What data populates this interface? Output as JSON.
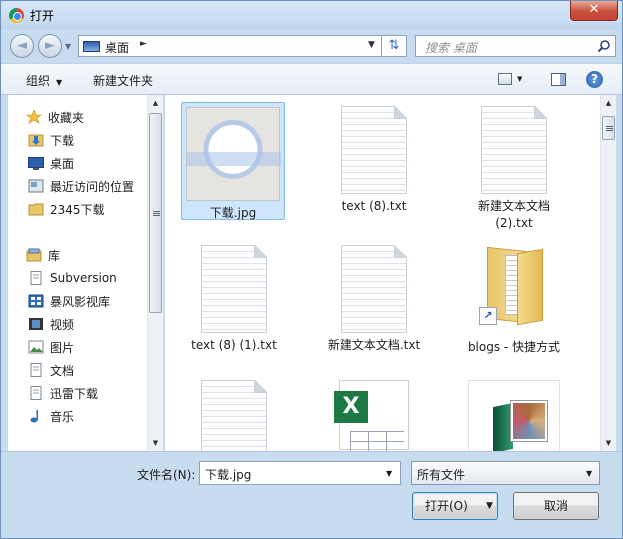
{
  "window": {
    "title": "打开",
    "close_glyph": "✕"
  },
  "nav": {
    "back_glyph": "◄",
    "forward_glyph": "►",
    "address": {
      "location": "桌面",
      "separator": "►"
    },
    "search_placeholder": "搜索 桌面"
  },
  "toolbar": {
    "organize_label": "组织",
    "new_folder_label": "新建文件夹",
    "help_glyph": "?"
  },
  "sidebar": {
    "items": [
      {
        "label": "收藏夹",
        "icon": "star-icon"
      },
      {
        "label": "下载",
        "icon": "download-folder-icon"
      },
      {
        "label": "桌面",
        "icon": "desktop-icon"
      },
      {
        "label": "最近访问的位置",
        "icon": "recent-places-icon"
      },
      {
        "label": "2345下载",
        "icon": "folder-icon"
      },
      {
        "label": "库",
        "icon": "library-icon"
      },
      {
        "label": "Subversion",
        "icon": "document-icon"
      },
      {
        "label": "暴风影视库",
        "icon": "video-library-icon"
      },
      {
        "label": "视频",
        "icon": "film-icon"
      },
      {
        "label": "图片",
        "icon": "picture-icon"
      },
      {
        "label": "文档",
        "icon": "document-icon"
      },
      {
        "label": "迅雷下载",
        "icon": "document-icon"
      },
      {
        "label": "音乐",
        "icon": "music-note-icon"
      }
    ]
  },
  "files": [
    {
      "label": "下载.jpg",
      "type": "image",
      "selected": true
    },
    {
      "label": "text (8).txt",
      "type": "text"
    },
    {
      "label": "新建文本文档 (2).txt",
      "type": "text"
    },
    {
      "label": "text (8) (1).txt",
      "type": "text"
    },
    {
      "label": "新建文本文档.txt",
      "type": "text"
    },
    {
      "label": "blogs - 快捷方式",
      "type": "folder-shortcut"
    },
    {
      "label": "",
      "type": "text"
    },
    {
      "label": "",
      "type": "excel"
    },
    {
      "label": "",
      "type": "photo-album"
    }
  ],
  "footer": {
    "filename_label": "文件名(N):",
    "filename_value": "下载.jpg",
    "filetype_value": "所有文件",
    "open_label": "打开(O)",
    "cancel_label": "取消"
  },
  "scrollbar_glyphs": {
    "up": "▲",
    "down": "▼"
  }
}
